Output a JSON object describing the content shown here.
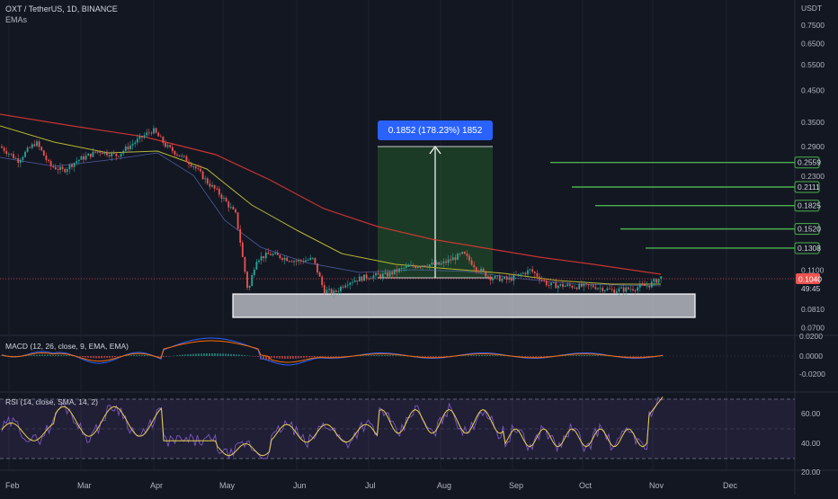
{
  "header": {
    "symbol_line": "OXT / TetherUS, 1D, BINANCE",
    "indicator": "EMAs"
  },
  "price_axis": {
    "currency": "USDT",
    "ticks": [
      "0.7500",
      "0.6500",
      "0.5500",
      "0.4500",
      "0.3500",
      "0.2900",
      "0.2300",
      "0.1100",
      "0.0810",
      "0.0700"
    ],
    "current_price": "0.1040",
    "countdown": "49:45"
  },
  "measure": {
    "label": "0.1852 (178.23%) 1852"
  },
  "target_levels": [
    "0.2559",
    "0.2111",
    "0.1825",
    "0.1520",
    "0.1308"
  ],
  "macd": {
    "label": "MACD (12, 26, close, 9, EMA, EMA)",
    "ticks": [
      "0.0200",
      "0.0000",
      "-0.0200"
    ]
  },
  "rsi": {
    "label": "RSI (14, close, SMA, 14, 2)",
    "ticks": [
      "60.00",
      "40.00",
      "20.00"
    ]
  },
  "time_axis": [
    "Feb",
    "Mar",
    "Apr",
    "May",
    "Jun",
    "Jul",
    "Aug",
    "Sep",
    "Oct",
    "Nov",
    "Dec"
  ],
  "colors": {
    "background": "#131722",
    "up": "#26a69a",
    "down": "#ef5350",
    "ema_red": "#e53935",
    "ema_yellow": "#b5b532",
    "target_line": "#4caf50",
    "measure_blue": "#2962ff",
    "rsi_line": "#7e57c2",
    "rsi_ma": "#e8d04a",
    "macd_line": "#2962ff",
    "signal_line": "#ff6d00"
  },
  "chart_data": {
    "type": "line",
    "title": "OXT / TetherUS, 1D, BINANCE",
    "scale": "log",
    "ylim": [
      0.065,
      0.85
    ],
    "x": [
      "Feb",
      "Mar",
      "Apr",
      "May",
      "Jun",
      "Jul",
      "Aug",
      "Sep",
      "Oct",
      "Nov"
    ],
    "series": [
      {
        "values": [
          0.275,
          0.295,
          0.345,
          0.255,
          0.096,
          0.102,
          0.115,
          0.104,
          0.098,
          0.104
        ]
      }
    ],
    "horizontal_levels": [
      0.2559,
      0.2111,
      0.1825,
      0.152,
      0.1308
    ],
    "support_zone": [
      0.076,
      0.092
    ],
    "measurement": {
      "from": 0.104,
      "to": 0.289,
      "change": 0.1852,
      "percent": 178.23
    }
  }
}
